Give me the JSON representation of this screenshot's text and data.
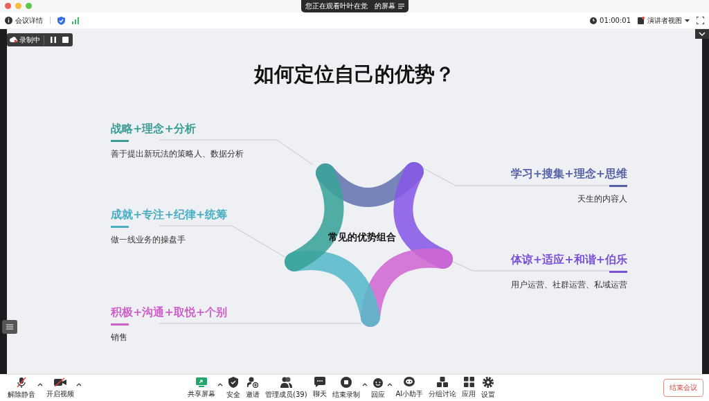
{
  "banner": {
    "viewer": "您正在观看叶叶在觉",
    "suffix": "的屏幕"
  },
  "info_bar": {
    "details": "会议详情",
    "timer": "01:00:01",
    "view_mode": "演讲者视图"
  },
  "recording": {
    "label": "录制中"
  },
  "slide": {
    "title": "如何定位自己的优势？",
    "center_label": "常见的优势组合",
    "combos": [
      {
        "title": "战略+理念+分析",
        "description": "善于提出新玩法的策略人、数据分析",
        "color": "#3a9e96"
      },
      {
        "title": "成就+专注+纪律+统筹",
        "description": "做一线业务的操盘手",
        "color": "#4aaec2"
      },
      {
        "title": "积极+沟通+取悦+个别",
        "description": "销售",
        "color": "#cf5fc9"
      },
      {
        "title": "学习+搜集+理念+思维",
        "description": "天生的内容人",
        "color": "#5662a6"
      },
      {
        "title": "体谅+适应+和谐+伯乐",
        "description": "用户运营、社群运营、私域运营",
        "color": "#7a4fd8"
      }
    ]
  },
  "toolbar": {
    "left": [
      {
        "label": "解除静音",
        "kind": "mic-muted",
        "menu": true
      },
      {
        "label": "开启视频",
        "kind": "camera-off",
        "menu": true
      }
    ],
    "center": [
      {
        "label": "共享屏幕",
        "kind": "share",
        "menu": true
      },
      {
        "label": "安全",
        "kind": "shield",
        "menu": false
      },
      {
        "label": "邀请",
        "kind": "invite",
        "menu": false
      },
      {
        "label": "管理成员(39)",
        "kind": "members",
        "menu": false
      },
      {
        "label": "聊天",
        "kind": "chat",
        "menu": false
      },
      {
        "label": "结束录制",
        "kind": "stop",
        "menu": true
      },
      {
        "label": "回应",
        "kind": "react",
        "menu": true
      },
      {
        "label": "AI小助手",
        "kind": "ai",
        "menu": false
      },
      {
        "label": "分组讨论",
        "kind": "groups",
        "menu": false
      },
      {
        "label": "应用",
        "kind": "apps",
        "menu": false
      },
      {
        "label": "设置",
        "kind": "gear",
        "menu": false
      }
    ],
    "end_button": "结束会议"
  }
}
